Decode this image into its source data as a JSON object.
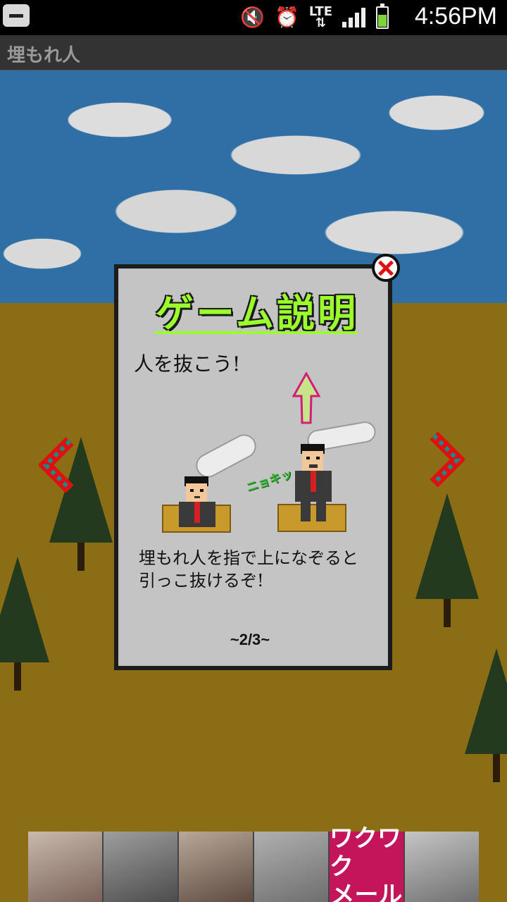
{
  "status_bar": {
    "time": "4:56PM",
    "network": "LTE",
    "icons": [
      "back-icon",
      "mute-icon",
      "alarm-icon",
      "lte-icon",
      "signal-icon",
      "battery-icon"
    ]
  },
  "app": {
    "title": "埋もれ人"
  },
  "dialog": {
    "title": "ゲーム説明",
    "heading": "人を抜こう!",
    "sfx": "ニョキッ",
    "body_line1": "埋もれ人を指で上になぞると",
    "body_line2": "引っこ抜けるぞ!",
    "pager": "~2/3~"
  },
  "ad": {
    "label_line1": "ワクワク",
    "label_line2": "メール"
  },
  "colors": {
    "title_green": "#9aff2a",
    "arrow_red": "#e01010",
    "ground": "#8a6d14",
    "sky": "#2f6fa6"
  }
}
